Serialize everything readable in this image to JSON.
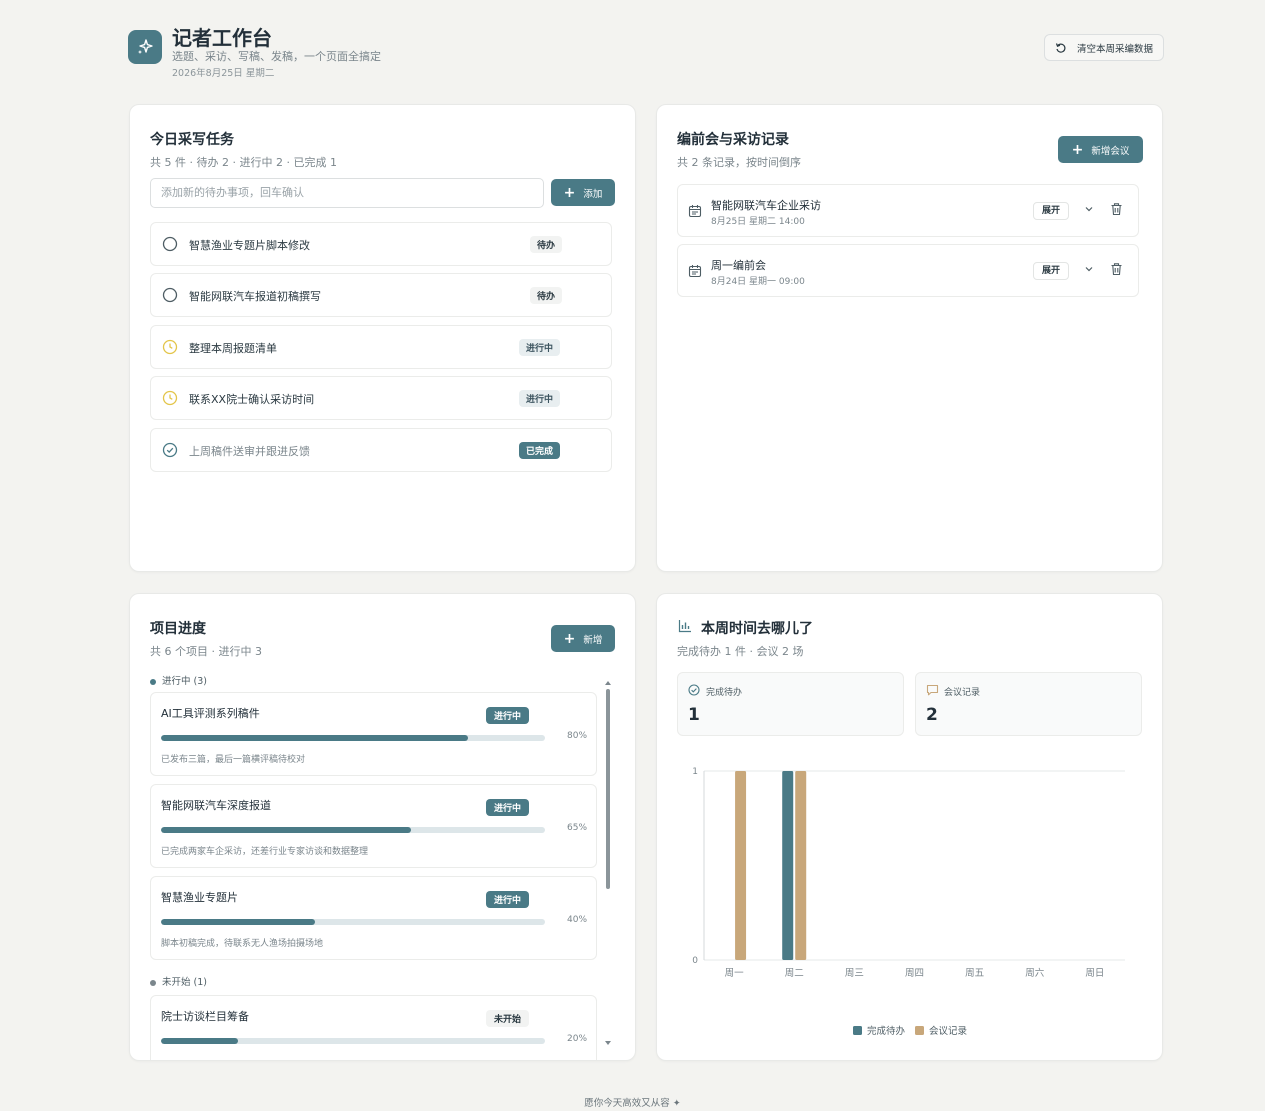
{
  "header": {
    "title": "记者工作台",
    "subtitle": "选题、采访、写稿、发稿，一个页面全搞定",
    "date": "2026年8月25日 星期二",
    "clear_button": "清空本周采编数据"
  },
  "tasks": {
    "title": "今日采写任务",
    "summary": "共 5 件 · 待办 2 · 进行中 2 · 已完成 1",
    "input_placeholder": "添加新的待办事项，回车确认",
    "add_button": "添加",
    "items": [
      {
        "label": "智慧渔业专题片脚本修改",
        "status": "待办",
        "state": "todo"
      },
      {
        "label": "智能网联汽车报道初稿撰写",
        "status": "待办",
        "state": "todo"
      },
      {
        "label": "整理本周报题清单",
        "status": "进行中",
        "state": "doing"
      },
      {
        "label": "联系XX院士确认采访时间",
        "status": "进行中",
        "state": "doing"
      },
      {
        "label": "上周稿件送审并跟进反馈",
        "status": "已完成",
        "state": "done"
      }
    ]
  },
  "meetings": {
    "title": "编前会与采访记录",
    "summary": "共 2 条记录，按时间倒序",
    "add_button": "新增会议",
    "items": [
      {
        "title": "智能网联汽车企业采访",
        "time": "8月25日 星期二 14:00",
        "expand": "展开"
      },
      {
        "title": "周一编前会",
        "time": "8月24日 星期一 09:00",
        "expand": "展开"
      }
    ]
  },
  "projects": {
    "title": "项目进度",
    "summary": "共 6 个项目 · 进行中 3",
    "add_button": "新增",
    "groups": [
      {
        "label": "进行中 (3)"
      },
      {
        "label": "未开始 (1)"
      }
    ],
    "items": [
      {
        "name": "AI工具评测系列稿件",
        "status": "进行中",
        "progress": 80,
        "progress_label": "80%",
        "note": "已发布三篇，最后一篇横评稿待校对"
      },
      {
        "name": "智能网联汽车深度报道",
        "status": "进行中",
        "progress": 65,
        "progress_label": "65%",
        "note": "已完成两家车企采访，还差行业专家访谈和数据整理"
      },
      {
        "name": "智慧渔业专题片",
        "status": "进行中",
        "progress": 40,
        "progress_label": "40%",
        "note": "脚本初稿完成，待联系无人渔场拍摄场地"
      },
      {
        "name": "院士访谈栏目筹备",
        "status": "未开始",
        "progress": 20,
        "progress_label": "20%",
        "note": ""
      }
    ]
  },
  "week": {
    "title": "本周时间去哪儿了",
    "summary": "完成待办 1 件 · 会议 2 场",
    "stat_done_label": "完成待办",
    "stat_done_value": "1",
    "stat_meet_label": "会议记录",
    "stat_meet_value": "2"
  },
  "chart_data": {
    "type": "bar",
    "categories": [
      "周一",
      "周二",
      "周三",
      "周四",
      "周五",
      "周六",
      "周日"
    ],
    "series": [
      {
        "name": "完成待办",
        "values": [
          0,
          1,
          0,
          0,
          0,
          0,
          0
        ],
        "color": "#4a7a86"
      },
      {
        "name": "会议记录",
        "values": [
          1,
          1,
          0,
          0,
          0,
          0,
          0
        ],
        "color": "#c8a77a"
      }
    ],
    "ylim": [
      0,
      1
    ],
    "yticks": [
      "0",
      "1"
    ],
    "grid": true,
    "legend": "bottom"
  },
  "colors": {
    "accent": "#4a7a86",
    "meeting": "#c8a77a",
    "doing": "#e3c54a"
  },
  "footer": "愿你今天高效又从容 ✦"
}
